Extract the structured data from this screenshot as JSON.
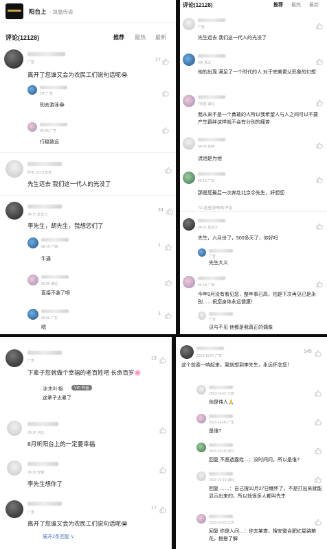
{
  "p1": {
    "app_title": "阳台上",
    "app_subtitle": "- 凤凰传奇",
    "comments_label": "评论(12128)",
    "sort": [
      "推荐",
      "最热",
      "最新"
    ],
    "comments": [
      {
        "meta": "广告",
        "count": "17",
        "text": "离开了您谁又会为农民工们说句话呢😭"
      },
      {
        "meta": "2天 广告",
        "text": "别去游泳😂",
        "reply": true
      },
      {
        "meta": "09-06 广告",
        "text": "行稳致远",
        "reply": true
      },
      {
        "meta": "昨天 15:19 甘肃",
        "text": "先生远去 我们这一代人的光没了"
      },
      {
        "meta": "08-15 黑龙江",
        "count": "24",
        "text": "李先生，胡先生，我想您们了"
      },
      {
        "meta": "08-16 广西",
        "count": "1",
        "text": "牛逼",
        "reply": true
      },
      {
        "meta": "09-06 湖北",
        "text": "直接不装了呗",
        "reply": true
      },
      {
        "meta": "08-06 广东",
        "count": "1",
        "text": "嗯",
        "reply": true
      }
    ]
  },
  "p2": {
    "comments_label": "评论(12128)",
    "sort": [
      "推荐",
      "最热",
      "最新"
    ],
    "comments": [
      {
        "meta": "广告",
        "text": "先生远去 我们这一代人的光没了"
      },
      {
        "meta": "4天 浙江",
        "text": "他的出现 满足了一个时代的人 对于完美君父形象的幻想"
      },
      {
        "meta": "7天前 湖北",
        "text": "我从来不是一个勇敢的人所以我希望人与人之间可以不要产生羁绊这样就不会有分别的痛苦"
      },
      {
        "meta": "09-05 吉林",
        "text": "流泪是为他"
      },
      {
        "meta": "09-16 广东",
        "text": "那是您最后一次奔赴北京😢先生，好想您"
      },
      {
        "meta": "TA 这些发布的评论"
      },
      {
        "meta": "08-21 黑龙江",
        "text": "先生，六月份了，500多天了，你好吗"
      },
      {
        "meta": "广告",
        "text": "先生大义",
        "reply": true
      },
      {
        "meta": "06-18 广西",
        "text": "今年9月没有看见您，整年事已高，怕是下次再见已是永别……祝您身体永远健康！"
      },
      {
        "meta": "广告",
        "text": "见与不见 他都是我真正的偶像",
        "reply": true
      }
    ]
  },
  "p3": {
    "comments": [
      {
        "meta": "广告",
        "count": "13",
        "text": "下辈子您就做个幸福的老百姓吧 长命百岁🌸"
      },
      {
        "meta": "冰木叶格",
        "badge": "VIP·作者",
        "text": "这辈子太累了",
        "reply": true
      },
      {
        "meta": "08-16 河北",
        "text": "8月听阳台上的一定要幸福"
      },
      {
        "meta": "08-16 安徽",
        "text": "李先生想你了"
      },
      {
        "meta": "广告",
        "count": "17",
        "text": "离开了您谁又会为农民工们说句话呢😭"
      }
    ],
    "expand": "展开2条回复 ∨"
  },
  "p4": {
    "comments": [
      {
        "meta": "2023-10-07 广东",
        "count": "149",
        "text": "这个前奏一响起来，我就想到李先生，永远怀念您！"
      },
      {
        "meta": "2023-10-22 江西",
        "text": "他是伟人🙏",
        "reply": true
      },
      {
        "meta": "2023-10-06 广东",
        "text": "是谁?",
        "reply": true
      },
      {
        "meta": "2023-10-03 浙江",
        "text": "回复 不愿透露姓…：没时间问，所以是谁?",
        "reply": true
      },
      {
        "meta": "2023-10-19 湖北",
        "text": "回复 ……：自己搜10月27日缅怀了，不是打出来就能显示出来的，所以就很多人都叫先生",
        "reply": true
      },
      {
        "meta": "2023-10-20 江苏",
        "text": "回复 你是人间…：你去某查，搜安徽合肥红星路粮花，搭搭了解",
        "reply": true
      }
    ]
  },
  "colors": {
    "accent": "#3f91d6",
    "separator": "#0d0d0d"
  }
}
